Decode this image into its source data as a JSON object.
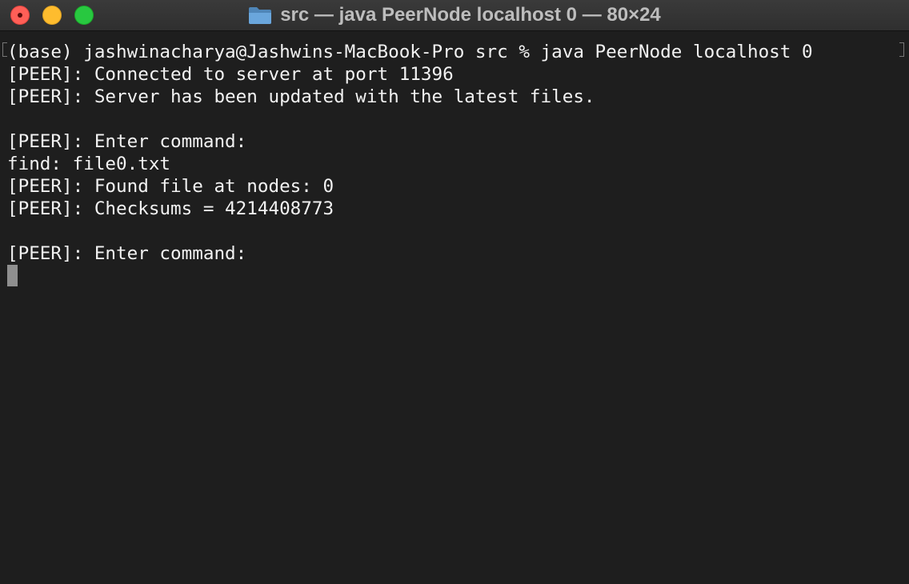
{
  "window": {
    "title": "src — java PeerNode localhost 0 — 80×24",
    "folder_icon": "folder-icon"
  },
  "terminal": {
    "lines": [
      "(base) jashwinacharya@Jashwins-MacBook-Pro src % java PeerNode localhost 0",
      "[PEER]: Connected to server at port 11396",
      "[PEER]: Server has been updated with the latest files.",
      "",
      "[PEER]: Enter command:",
      "find: file0.txt",
      "[PEER]: Found file at nodes: 0",
      "[PEER]: Checksums = 4214408773",
      "",
      "[PEER]: Enter command:"
    ]
  },
  "colors": {
    "background": "#1e1e1e",
    "text": "#f2f2f2",
    "cursor": "#8f8f8f",
    "close": "#ff5f57",
    "minimize": "#febc2e",
    "maximize": "#28c840"
  }
}
